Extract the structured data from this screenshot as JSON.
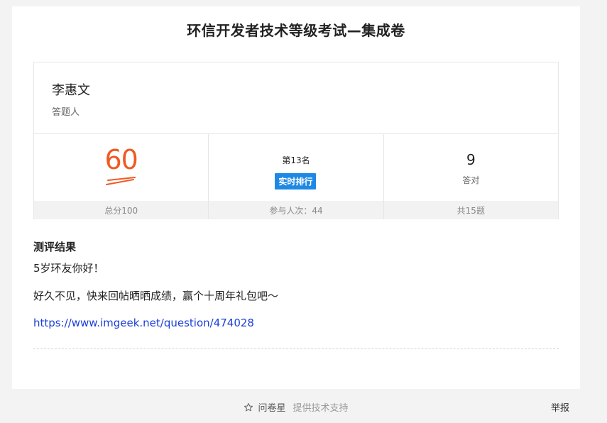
{
  "page": {
    "title": "环信开发者技术等级考试—集成卷"
  },
  "respondent": {
    "name": "李惠文",
    "label": "答题人"
  },
  "stats": {
    "score": {
      "value": "60",
      "footer": "总分100"
    },
    "rank": {
      "text": "第13名",
      "button_label": "实时排行",
      "footer": "参与人次：44"
    },
    "correct": {
      "value": "9",
      "label": "答对",
      "footer": "共15题"
    }
  },
  "result": {
    "heading": "测评结果",
    "line1": "5岁环友你好！",
    "line2": "好久不见，快来回帖晒晒成绩，赢个十周年礼包吧～",
    "link": "https://www.imgeek.net/question/474028"
  },
  "footer": {
    "brand": "问卷星",
    "support": "提供技术支持",
    "report": "举报",
    "star_icon": "star-outline-icon"
  },
  "colors": {
    "score": "#f05a22",
    "rank_button": "#1e88e5",
    "link": "#1a3fd8"
  }
}
